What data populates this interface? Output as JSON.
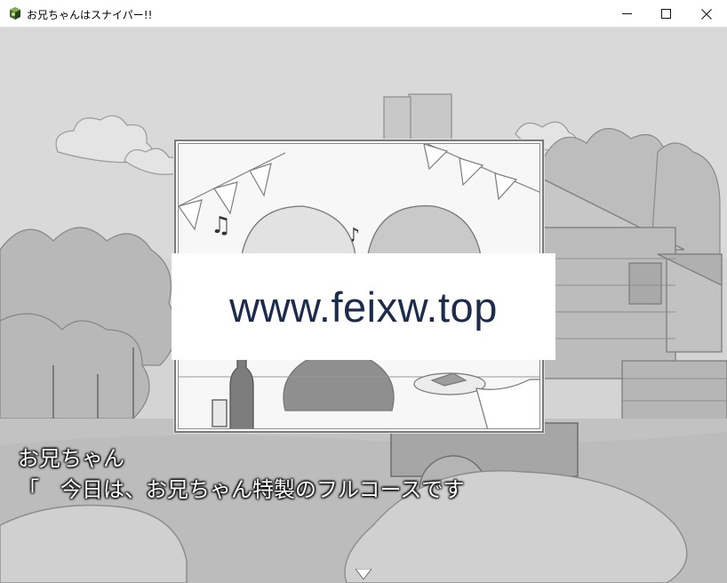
{
  "window": {
    "title": "お兄ちゃんはスナイパー!!",
    "minimize_icon": "minimize-icon",
    "maximize_icon": "maximize-icon",
    "close_icon": "close-icon"
  },
  "overlay": {
    "watermark": "www.feixw.top"
  },
  "dialogue": {
    "speaker": "お兄ちゃん",
    "text": "「　今日は、お兄ちゃん特製のフルコースです"
  },
  "colors": {
    "titlebar_bg": "#ffffff",
    "scene_gray": "#cfcfcf",
    "dialogue_text": "#ffffff",
    "watermark_text": "#1d2b4d"
  }
}
